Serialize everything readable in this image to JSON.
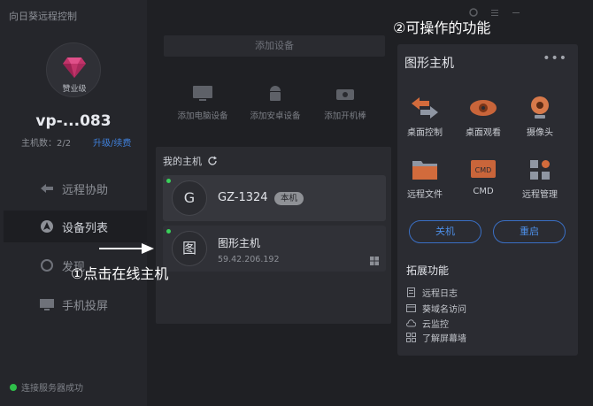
{
  "app": {
    "title": "向日葵远程控制"
  },
  "account": {
    "vip_label": "赞业级",
    "device_id": "vp-...083",
    "host_count": "主机数：2/2",
    "upgrade_link": "升级/续费"
  },
  "nav": [
    {
      "label": "远程协助",
      "icon": "remote-assist-icon"
    },
    {
      "label": "设备列表",
      "icon": "device-list-icon"
    },
    {
      "label": "发现",
      "icon": "discover-icon"
    },
    {
      "label": "手机投屏",
      "icon": "phone-cast-icon"
    }
  ],
  "status": {
    "text": "连接服务器成功",
    "color": "#2fbf4a"
  },
  "add_device": {
    "bar_label": "添加设备",
    "quick": [
      {
        "label": "添加电脑设备",
        "icon": "monitor-icon"
      },
      {
        "label": "添加安卓设备",
        "icon": "android-icon"
      },
      {
        "label": "添加开机棒",
        "icon": "power-stick-icon"
      }
    ]
  },
  "hosts": {
    "title": "我的主机",
    "items": [
      {
        "avatar": "G",
        "name": "GZ-1324",
        "badge": "本机",
        "online": true
      },
      {
        "avatar": "图",
        "name": "图形主机",
        "ip": "59.42.206.192",
        "online": true,
        "os_icon": "windows-icon"
      }
    ]
  },
  "callouts": {
    "step1": "①点击在线主机",
    "step2": "②可操作的功能"
  },
  "functions": {
    "title": "图形主机",
    "more": "•••",
    "items": [
      {
        "label": "桌面控制",
        "icon": "desktop-control-icon"
      },
      {
        "label": "桌面观看",
        "icon": "eye-icon"
      },
      {
        "label": "摄像头",
        "icon": "camera-icon"
      },
      {
        "label": "远程文件",
        "icon": "folder-icon"
      },
      {
        "label": "CMD",
        "icon": "cmd-icon"
      },
      {
        "label": "远程管理",
        "icon": "manage-icon"
      }
    ],
    "shutdown": "关机",
    "restart": "重启",
    "ext_title": "拓展功能",
    "ext_items": [
      {
        "label": "远程日志",
        "icon": "log-icon"
      },
      {
        "label": "葵域名访问",
        "icon": "domain-icon"
      },
      {
        "label": "云监控",
        "icon": "cloud-icon"
      },
      {
        "label": "了解屏幕墙",
        "icon": "screen-wall-icon"
      }
    ],
    "accent": "#4d8fe8"
  }
}
